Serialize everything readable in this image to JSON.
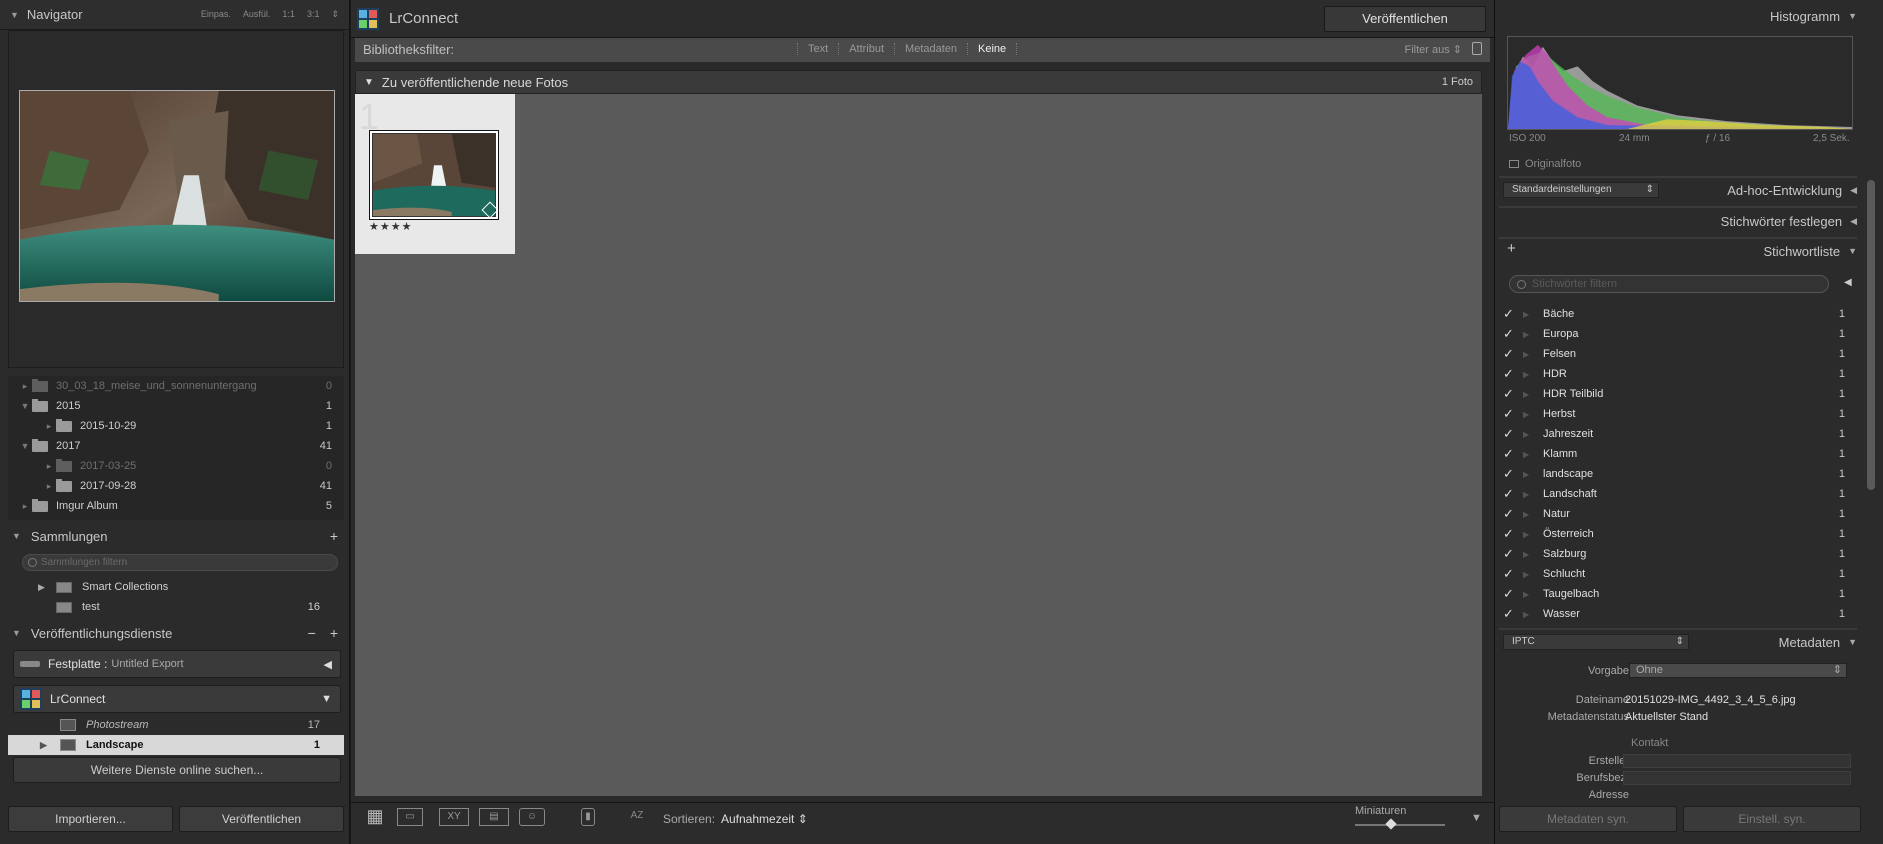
{
  "left": {
    "navigator": {
      "title": "Navigator",
      "zoom": [
        "Einpas.",
        "Ausfül.",
        "1:1",
        "3:1"
      ]
    },
    "folders": [
      {
        "name": "30_03_18_meise_und_sonnenuntergang",
        "count": "0",
        "dim": true
      },
      {
        "name": "2015",
        "count": "1"
      },
      {
        "name": "2015-10-29",
        "count": "1"
      },
      {
        "name": "2017",
        "count": "41"
      },
      {
        "name": "2017-03-25",
        "count": "0",
        "dim": true
      },
      {
        "name": "2017-09-28",
        "count": "41"
      },
      {
        "name": "Imgur Album",
        "count": "5"
      }
    ],
    "collections": {
      "title": "Sammlungen",
      "filter_placeholder": "Sammlungen filtern",
      "items": [
        {
          "name": "Smart Collections",
          "count": ""
        },
        {
          "name": "test",
          "count": "16"
        }
      ]
    },
    "publish": {
      "title": "Veröffentlichungsdienste",
      "festplatte": "Festplatte :",
      "festplatte_sub": "Untitled Export",
      "lrconnect": "LrConnect",
      "items": [
        {
          "name": "Photostream",
          "count": "17"
        },
        {
          "name": "Landscape",
          "count": "1"
        }
      ],
      "more": "Weitere Dienste online suchen..."
    },
    "import_label": "Importieren...",
    "publish_label": "Veröffentlichen"
  },
  "center": {
    "title": "LrConnect",
    "publish_btn": "Veröffentlichen",
    "filter": {
      "label": "Bibliotheksfilter:",
      "options": [
        "Text",
        "Attribut",
        "Metadaten",
        "Keine"
      ],
      "active": "Keine",
      "filter_off": "Filter aus"
    },
    "group": {
      "title": "Zu veröffentlichende neue Fotos",
      "count": "1 Foto"
    },
    "cell": {
      "index": "1",
      "stars": "★★★★"
    },
    "toolbar": {
      "sort_label": "Sortieren:",
      "sort_value": "Aufnahmezeit",
      "mini_label": "Miniaturen",
      "az": "AZ"
    }
  },
  "right": {
    "histogram": {
      "title": "Histogramm",
      "iso": "ISO 200",
      "focal": "24 mm",
      "aperture": "ƒ / 16",
      "shutter": "2,5 Sek.",
      "original": "Originalfoto"
    },
    "quick": {
      "preset": "Standardeinstellungen",
      "title": "Ad-hoc-Entwicklung"
    },
    "keywording": "Stichwörter festlegen",
    "keywordlist": {
      "title": "Stichwortliste",
      "filter_placeholder": "Stichwörter filtern",
      "items": [
        {
          "name": "Bäche",
          "count": "1"
        },
        {
          "name": "Europa",
          "count": "1"
        },
        {
          "name": "Felsen",
          "count": "1"
        },
        {
          "name": "HDR",
          "count": "1"
        },
        {
          "name": "HDR Teilbild",
          "count": "1"
        },
        {
          "name": "Herbst",
          "count": "1"
        },
        {
          "name": "Jahreszeit",
          "count": "1"
        },
        {
          "name": "Klamm",
          "count": "1"
        },
        {
          "name": "landscape",
          "count": "1"
        },
        {
          "name": "Landschaft",
          "count": "1"
        },
        {
          "name": "Natur",
          "count": "1"
        },
        {
          "name": "Österreich",
          "count": "1"
        },
        {
          "name": "Salzburg",
          "count": "1"
        },
        {
          "name": "Schlucht",
          "count": "1"
        },
        {
          "name": "Taugelbach",
          "count": "1"
        },
        {
          "name": "Wasser",
          "count": "1"
        }
      ]
    },
    "metadata": {
      "set": "IPTC",
      "title": "Metadaten",
      "preset_label": "Vorgabe",
      "preset_value": "Ohne",
      "filename_label": "Dateiname",
      "filename": "20151029-IMG_4492_3_4_5_6.jpg",
      "status_label": "Metadatenstatus",
      "status": "Aktuellster Stand",
      "contact": "Kontakt",
      "creator": "Ersteller",
      "job": "Berufsbez.",
      "address": "Adresse"
    },
    "sync_meta": "Metadaten syn.",
    "sync_settings": "Einstell. syn."
  }
}
